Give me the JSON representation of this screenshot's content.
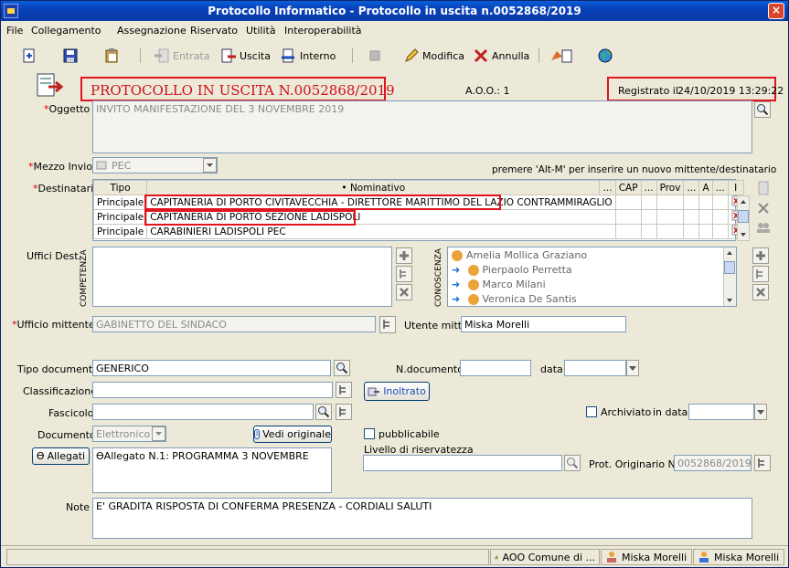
{
  "window": {
    "title": "Protocollo Informatico - Protocollo in uscita n.0052868/2019",
    "close_label": "×"
  },
  "menu": [
    {
      "label": "File"
    },
    {
      "label": "Collegamento"
    },
    {
      "label": "Assegnazione"
    },
    {
      "label": "Riservato"
    },
    {
      "label": "Utilità"
    },
    {
      "label": "Interoperabilità"
    }
  ],
  "toolbar": {
    "entrata": "Entrata",
    "uscita": "Uscita",
    "interno": "Interno",
    "modifica": "Modifica",
    "annulla": "Annulla"
  },
  "header": {
    "protocol_title": "PROTOCOLLO IN USCITA N.0052868/2019",
    "aoo": "A.O.O.: 1",
    "registrato_label": "Registrato il",
    "registrato_value": "24/10/2019 13:29:22"
  },
  "oggetto": {
    "label": "Oggetto",
    "value": "INVITO MANIFESTAZIONE DEL 3 NOVEMBRE 2019"
  },
  "mezzo_invio": {
    "label": "Mezzo Invio",
    "value": "PEC",
    "hint": "premere 'Alt-M' per inserire un nuovo mittente/destinatario"
  },
  "destinatari": {
    "label": "Destinatari",
    "columns": [
      "Tipo",
      "Nominativo",
      "...",
      "CAP",
      "...",
      "Prov",
      "...",
      "A",
      "...",
      "I"
    ],
    "rows": [
      {
        "tipo": "Principale",
        "nominativo": "CAPITANERIA DI PORTO CIVITAVECCHIA - DIRETTORE MARITTIMO DEL LAZIO CONTRAMMIRAGLIO"
      },
      {
        "tipo": "Principale",
        "nominativo": "CAPITANERIA DI PORTO SEZIONE LADISPOLI"
      },
      {
        "tipo": "Principale",
        "nominativo": "CARABINIERI LADISPOLI PEC"
      }
    ]
  },
  "uffici_dest": {
    "label": "Uffici Dest.",
    "competenza_label": "COMPETENZA",
    "conoscenza_label": "CONOSCENZA",
    "conoscenza": [
      "Amelia Mollica Graziano",
      "Pierpaolo Perretta",
      "Marco Milani",
      "Veronica De Santis"
    ]
  },
  "ufficio_mittente": {
    "label": "Ufficio mittente",
    "value": "GABINETTO DEL SINDACO",
    "utente_label": "Utente mitt.",
    "utente_value": "Miska Morelli"
  },
  "tipo_documento": {
    "label": "Tipo documento",
    "value": "GENERICO",
    "ndoc_label": "N.documento",
    "data_label": "data"
  },
  "classificazione": {
    "label": "Classificazione",
    "inoltrato": "Inoltrato"
  },
  "fascicolo": {
    "label": "Fascicolo",
    "archiviato": "Archiviato",
    "in_data": "in data"
  },
  "documento": {
    "label": "Documento",
    "value": "Elettronico",
    "vedi_originale": "Vedi originale",
    "pubblicabile": "pubblicabile"
  },
  "allegati": {
    "button": "Allegati",
    "value": "Allegato N.1: PROGRAMMA 3 NOVEMBRE",
    "riservatezza_label": "Livello di riservatezza",
    "prot_orig_label": "Prot. Originario N.",
    "prot_orig_value": "0052868/2019"
  },
  "note": {
    "label": "Note",
    "value": "E' GRADITA RISPOSTA DI CONFERMA PRESENZA - CORDIALI SALUTI"
  },
  "statusbar": {
    "aoo": "AOO Comune di ...",
    "user1": "Miska Morelli",
    "user2": "Miska Morelli"
  },
  "colors": {
    "highlight_red": "#e0141e",
    "title_blue": "#0841b9"
  }
}
